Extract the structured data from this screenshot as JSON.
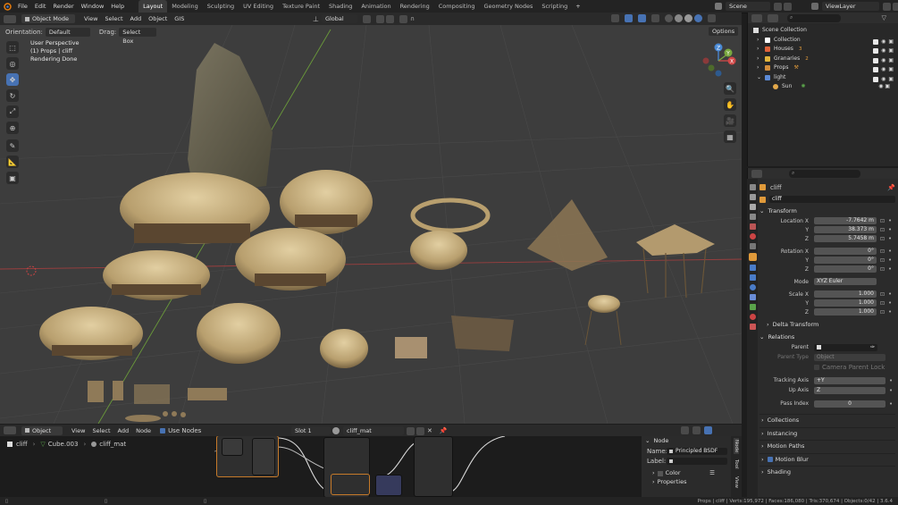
{
  "menu": [
    "File",
    "Edit",
    "Render",
    "Window",
    "Help"
  ],
  "workspaces": [
    {
      "label": "Layout",
      "active": true
    },
    {
      "label": "Modeling"
    },
    {
      "label": "Sculpting"
    },
    {
      "label": "UV Editing"
    },
    {
      "label": "Texture Paint"
    },
    {
      "label": "Shading"
    },
    {
      "label": "Animation"
    },
    {
      "label": "Rendering"
    },
    {
      "label": "Compositing"
    },
    {
      "label": "Geometry Nodes"
    },
    {
      "label": "Scripting"
    }
  ],
  "add_workspace": "+",
  "scene": "Scene",
  "view_layer": "ViewLayer",
  "viewport_header": {
    "mode": "Object Mode",
    "menus": [
      "View",
      "Select",
      "Add",
      "Object",
      "GIS"
    ],
    "transform_space": "Global"
  },
  "tool_settings": {
    "orientation_label": "Orientation:",
    "orientation": "Default",
    "drag_label": "Drag:",
    "drag": "Select Box",
    "options": "Options"
  },
  "viewport_overlay": {
    "perspective": "User Perspective",
    "context": "(1) Props | cliff",
    "render_status": "Rendering Done"
  },
  "gizmo": {
    "x": "X",
    "y": "Y",
    "z": "Z"
  },
  "outliner": {
    "root": "Scene Collection",
    "items": [
      {
        "label": "Collection",
        "color": "#ffffff"
      },
      {
        "label": "Houses",
        "color": "#e0633a"
      },
      {
        "label": "Granaries",
        "color": "#e3b53c"
      },
      {
        "label": "Props",
        "color": "#d48e3b"
      },
      {
        "label": "light",
        "color": "#5d8bd6"
      }
    ],
    "child": "Sun",
    "badges": [
      "3",
      "2"
    ]
  },
  "properties": {
    "object_name": "cliff",
    "object_field": "cliff",
    "transform": {
      "header": "Transform",
      "location_x_label": "Location X",
      "location_x": "-7.7642 m",
      "location_y_label": "Y",
      "location_y": "38.373 m",
      "location_z_label": "Z",
      "location_z": "5.7458 m",
      "rotation_x_label": "Rotation X",
      "rotation_x": "0°",
      "rotation_y_label": "Y",
      "rotation_y": "0°",
      "rotation_z_label": "Z",
      "rotation_z": "0°",
      "mode_label": "Mode",
      "mode": "XYZ Euler",
      "scale_x_label": "Scale X",
      "scale_x": "1.000",
      "scale_y_label": "Y",
      "scale_y": "1.000",
      "scale_z_label": "Z",
      "scale_z": "1.000"
    },
    "delta_transform": "Delta Transform",
    "relations": {
      "header": "Relations",
      "parent_label": "Parent",
      "parent_type_label": "Parent Type",
      "parent_type": "Object",
      "camera_parent_lock": "Camera Parent Lock",
      "tracking_axis_label": "Tracking Axis",
      "tracking_axis": "+Y",
      "up_axis_label": "Up Axis",
      "up_axis": "Z",
      "pass_index_label": "Pass Index",
      "pass_index": "0"
    },
    "collapsed_panels": [
      "Collections",
      "Instancing",
      "Motion Paths",
      "Motion Blur",
      "Shading"
    ]
  },
  "node_editor": {
    "type": "Object",
    "menus": [
      "View",
      "Select",
      "Add",
      "Node"
    ],
    "use_nodes": "Use Nodes",
    "slot": "Slot 1",
    "material": "cliff_mat",
    "breadcrumb": [
      "cliff",
      "Cube.003",
      "cliff_mat"
    ],
    "sidebar": {
      "header": "Node",
      "name_label": "Name:",
      "name": "Principled BSDF",
      "label_label": "Label:",
      "color": "Color",
      "properties": "Properties"
    },
    "side_tabs": [
      "Node",
      "Tool",
      "View"
    ]
  },
  "status_bar": "Props | cliff | Verts:195,972 | Faces:186,080 | Tris:370,674 | Objects:0/42 | 3.6.4"
}
